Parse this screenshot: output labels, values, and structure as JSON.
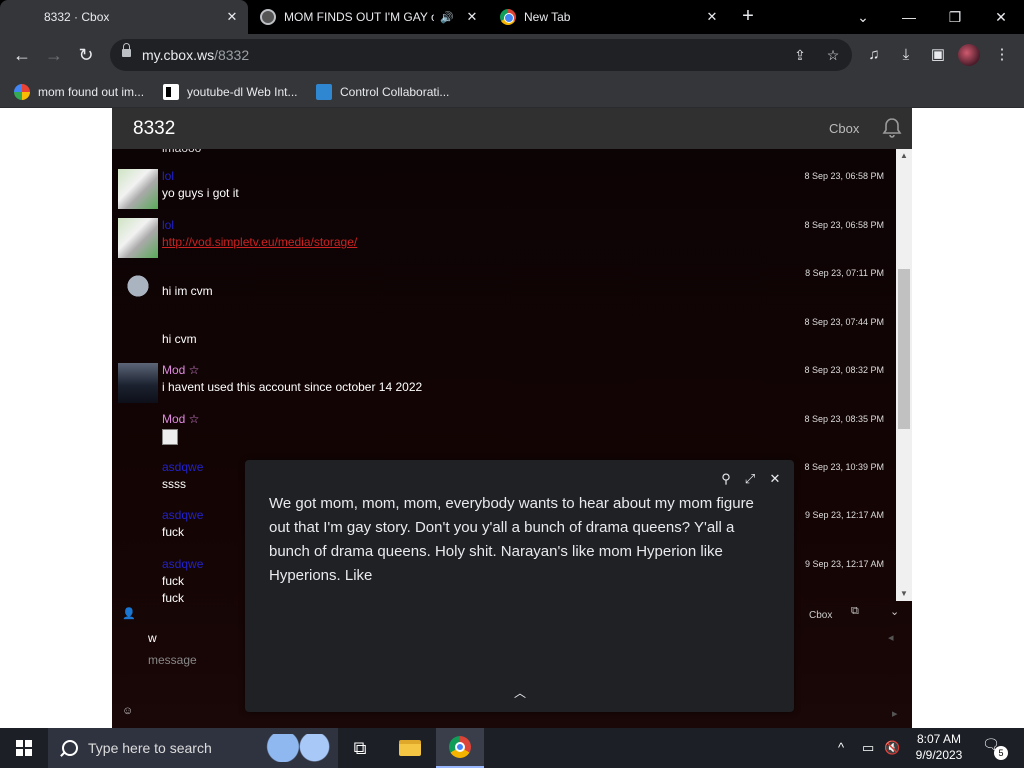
{
  "browser": {
    "tabs": [
      {
        "title": "8332 · Cbox",
        "active": true
      },
      {
        "title": "MOM FINDS OUT I'M GAY o",
        "audio": true
      },
      {
        "title": "New Tab"
      }
    ],
    "url_domain": "my.cbox.ws",
    "url_path": "/8332",
    "bookmarks": [
      {
        "label": "mom found out im...",
        "icon": "google-icon"
      },
      {
        "label": "youtube-dl Web Int...",
        "icon": "youtube-dl-icon"
      },
      {
        "label": "Control Collaborati...",
        "icon": "monitor-icon"
      }
    ]
  },
  "cbox": {
    "room": "8332",
    "brand": "Cbox",
    "messages": [
      {
        "name": "",
        "lines": [
          "lmaooo"
        ],
        "time": ""
      },
      {
        "name": "lol",
        "lines": [
          "yo guys i got it"
        ],
        "time": "8 Sep 23, 06:58 PM"
      },
      {
        "name": "lol",
        "lines": [
          "http://vod.simpletv.eu/media/storage/"
        ],
        "time": "8 Sep 23, 06:58 PM",
        "link": true
      },
      {
        "name": "",
        "lines": [
          "hi im cvm"
        ],
        "time": "8 Sep 23, 07:11 PM"
      },
      {
        "name": "",
        "lines": [
          "hi cvm"
        ],
        "time": "8 Sep 23, 07:44 PM"
      },
      {
        "name": "Mod ☆",
        "lines": [
          "i havent used this account since october 14 2022"
        ],
        "time": "8 Sep 23, 08:32 PM"
      },
      {
        "name": "Mod ☆",
        "lines": [],
        "time": "8 Sep 23, 08:35 PM",
        "image": true
      },
      {
        "name": "asdqwe",
        "lines": [
          "ssss"
        ],
        "time": "8 Sep 23, 10:39 PM"
      },
      {
        "name": "asdqwe",
        "lines": [
          "fuck"
        ],
        "time": "9 Sep 23, 12:17 AM"
      },
      {
        "name": "asdqwe",
        "lines": [
          "fuck",
          "fuck"
        ],
        "time": "9 Sep 23, 12:17 AM"
      }
    ],
    "footer": {
      "cbox_label": "Cbox",
      "name_value": "w",
      "message_placeholder": "message"
    }
  },
  "live_caption": {
    "text": " We got mom, mom, mom, everybody wants to hear about my mom figure out that I'm gay story. Don't you y'all a bunch of drama queens? Y'all a bunch of drama queens. Holy shit. Narayan's like mom Hyperion like Hyperions. Like"
  },
  "taskbar": {
    "search_placeholder": "Type here to search",
    "time": "8:07 AM",
    "date": "9/9/2023",
    "notifications": "5"
  },
  "colors": {
    "chrome_frame": "#000000",
    "chrome_toolbar": "#35363a",
    "cbox_header": "#303030",
    "chat_bg": "#140404",
    "mod_name": "#e08ae0",
    "user_name": "#2222cc",
    "link": "#cc2222"
  }
}
